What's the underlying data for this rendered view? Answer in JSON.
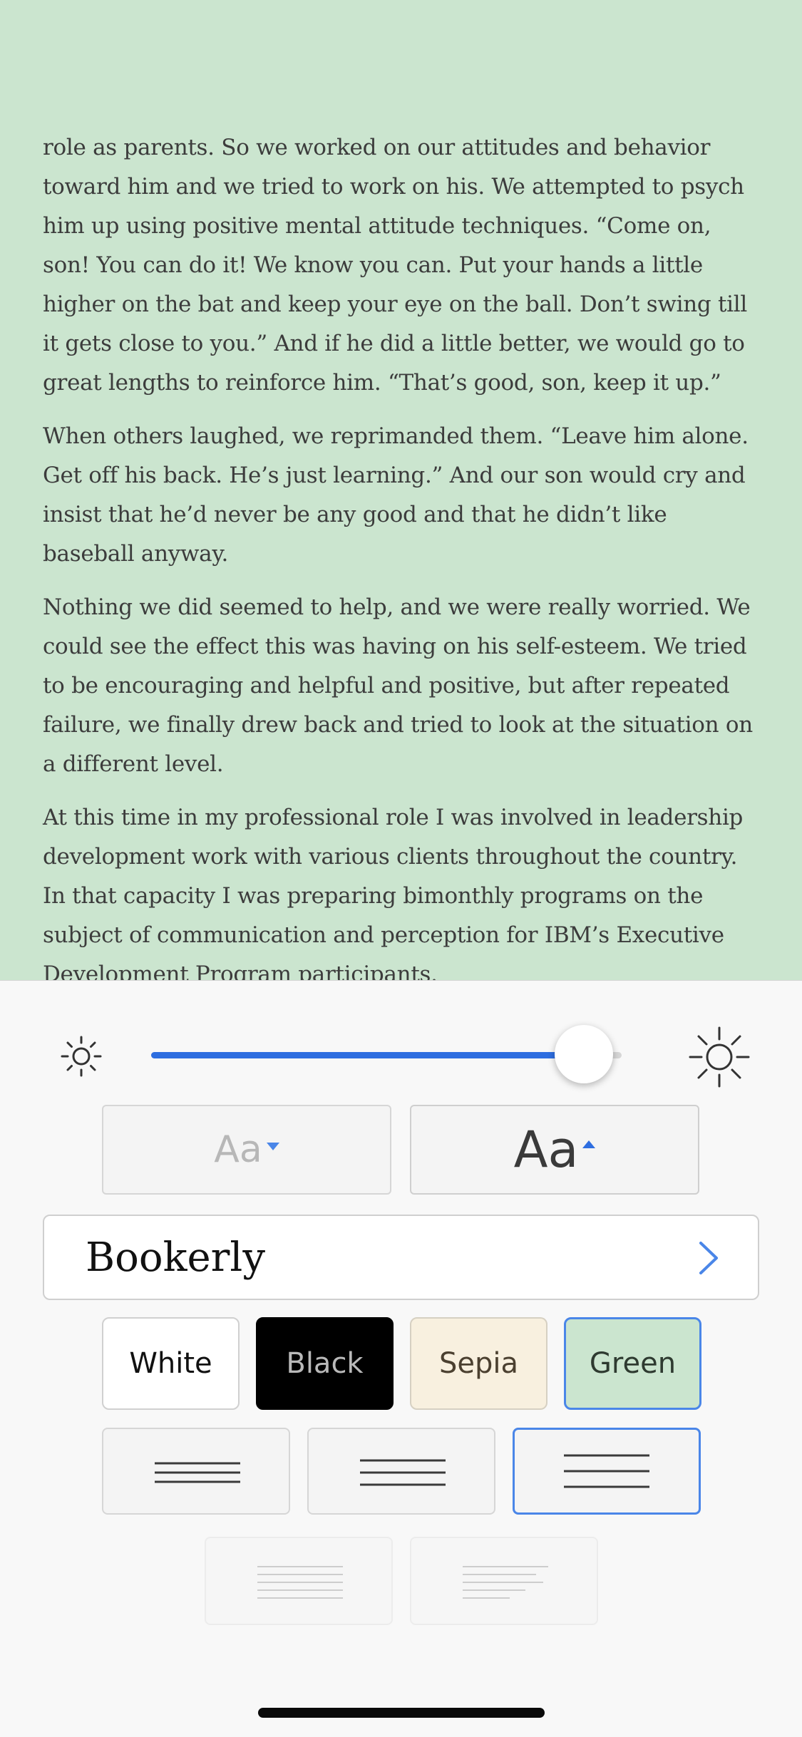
{
  "reader": {
    "paragraphs": [
      "role as parents. So we worked on our attitudes and behavior toward him and we tried to work on his. We attempted to psych him up using positive mental attitude techniques. “Come on, son! You can do it! We know you can. Put your hands a little higher on the bat and keep your eye on the ball. Don’t swing till it gets close to you.” And if he did a little better, we would go to great lengths to reinforce him. “That’s good, son, keep it up.”",
      "When others laughed, we reprimanded them. “Leave him alone. Get off his back. He’s just learning.” And our son would cry and insist that he’d never be any good and that he didn’t like baseball anyway.",
      "Nothing we did seemed to help, and we were really worried. We could see the effect this was having on his self-esteem. We tried to be encouraging and helpful and positive, but after repeated failure, we finally drew back and tried to look at the situation on a different level.",
      "At this time in my professional role I was involved in leadership development work with various clients throughout the country. In that capacity I was preparing bimonthly programs on the subject of communication and perception for IBM’s Executive Development Program participants."
    ],
    "background_color": "#cbe5cf"
  },
  "brightness": {
    "level": 0.92,
    "icon_low": "sun-small-icon",
    "icon_high": "sun-large-icon",
    "accent": "#2e6ee0"
  },
  "font_size": {
    "smaller_label": "Aa",
    "larger_label": "Aa"
  },
  "font": {
    "selected": "Bookerly",
    "icon": "chevron-right-icon"
  },
  "themes": {
    "options": [
      "White",
      "Black",
      "Sepia",
      "Green"
    ],
    "selected": "Green",
    "selected_border": "#4a86e8"
  },
  "line_spacing": {
    "options": [
      "compact",
      "medium",
      "wide"
    ],
    "selected": "wide"
  },
  "alignment": {
    "options": [
      "justified",
      "left-aligned"
    ]
  }
}
